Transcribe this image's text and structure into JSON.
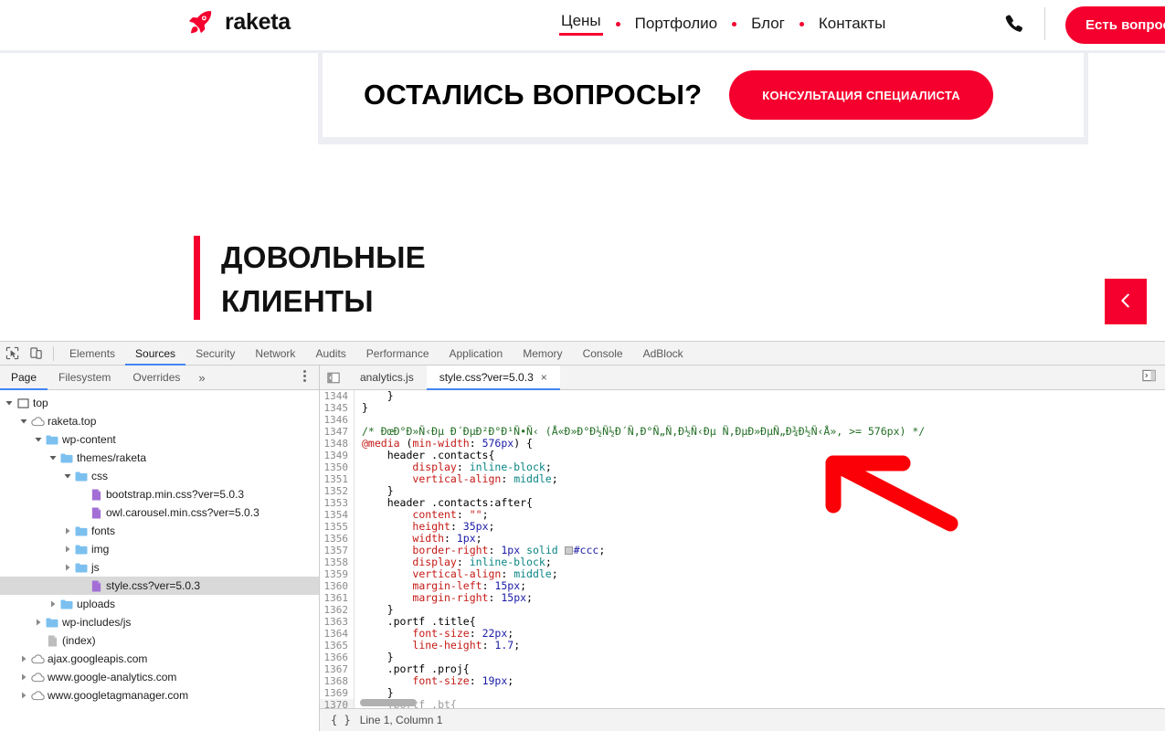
{
  "site": {
    "logo_text": "raketa",
    "logo_icon": "rocket-icon",
    "nav": [
      {
        "label": "Цены",
        "active": true
      },
      {
        "label": "Портфолио",
        "active": false
      },
      {
        "label": "Блог",
        "active": false
      },
      {
        "label": "Контакты",
        "active": false
      }
    ],
    "phone_icon": "phone-icon",
    "cta_label": "Есть вопросы?",
    "banner": {
      "title": "ОСТАЛИСЬ ВОПРОСЫ?",
      "button_label": "КОНСУЛЬТАЦИЯ СПЕЦИАЛИСТА"
    },
    "clients": {
      "line1": "ДОВОЛЬНЫЕ",
      "line2": "КЛИЕНТЫ"
    },
    "carousel_prev_icon": "chevron-left-icon",
    "colors": {
      "accent": "#f5002e",
      "banner_bg": "#eceef4",
      "text": "#111111"
    }
  },
  "devtools": {
    "left_icons": [
      "inspect-element-icon",
      "device-toolbar-icon"
    ],
    "tabs": [
      {
        "label": "Elements",
        "active": false
      },
      {
        "label": "Sources",
        "active": true
      },
      {
        "label": "Security",
        "active": false
      },
      {
        "label": "Network",
        "active": false
      },
      {
        "label": "Audits",
        "active": false
      },
      {
        "label": "Performance",
        "active": false
      },
      {
        "label": "Application",
        "active": false
      },
      {
        "label": "Memory",
        "active": false
      },
      {
        "label": "Console",
        "active": false
      },
      {
        "label": "AdBlock",
        "active": false
      }
    ],
    "navigator": {
      "subtabs": [
        {
          "label": "Page",
          "active": true
        },
        {
          "label": "Filesystem",
          "active": false
        },
        {
          "label": "Overrides",
          "active": false
        }
      ],
      "more_label": "»",
      "menu_icon": "kebab-menu-icon",
      "tree": [
        {
          "label": "top",
          "indent": 0,
          "icon": "frame-icon",
          "arrow": "expanded",
          "selected": false
        },
        {
          "label": "raketa.top",
          "indent": 1,
          "icon": "cloud-icon",
          "arrow": "expanded",
          "selected": false
        },
        {
          "label": "wp-content",
          "indent": 2,
          "icon": "folder-icon",
          "arrow": "expanded",
          "selected": false
        },
        {
          "label": "themes/raketa",
          "indent": 3,
          "icon": "folder-icon",
          "arrow": "expanded",
          "selected": false
        },
        {
          "label": "css",
          "indent": 4,
          "icon": "folder-icon",
          "arrow": "expanded",
          "selected": false
        },
        {
          "label": "bootstrap.min.css?ver=5.0.3",
          "indent": 5,
          "icon": "css-file-icon",
          "arrow": "none",
          "selected": false
        },
        {
          "label": "owl.carousel.min.css?ver=5.0.3",
          "indent": 5,
          "icon": "css-file-icon",
          "arrow": "none",
          "selected": false
        },
        {
          "label": "fonts",
          "indent": 4,
          "icon": "folder-icon",
          "arrow": "collapsed",
          "selected": false
        },
        {
          "label": "img",
          "indent": 4,
          "icon": "folder-icon",
          "arrow": "collapsed",
          "selected": false
        },
        {
          "label": "js",
          "indent": 4,
          "icon": "folder-icon",
          "arrow": "collapsed",
          "selected": false
        },
        {
          "label": "style.css?ver=5.0.3",
          "indent": 5,
          "icon": "css-file-icon",
          "arrow": "none",
          "selected": true
        },
        {
          "label": "uploads",
          "indent": 3,
          "icon": "folder-icon",
          "arrow": "collapsed",
          "selected": false
        },
        {
          "label": "wp-includes/js",
          "indent": 2,
          "icon": "folder-icon",
          "arrow": "collapsed",
          "selected": false
        },
        {
          "label": "(index)",
          "indent": 2,
          "icon": "doc-file-icon",
          "arrow": "none",
          "selected": false
        },
        {
          "label": "ajax.googleapis.com",
          "indent": 1,
          "icon": "cloud-icon",
          "arrow": "collapsed",
          "selected": false
        },
        {
          "label": "www.google-analytics.com",
          "indent": 1,
          "icon": "cloud-icon",
          "arrow": "collapsed",
          "selected": false
        },
        {
          "label": "www.googletagmanager.com",
          "indent": 1,
          "icon": "cloud-icon",
          "arrow": "collapsed",
          "selected": false
        }
      ]
    },
    "editor": {
      "panel_icon_left": "show-navigator-icon",
      "panel_icon_right": "show-sidebar-icon",
      "tabs": [
        {
          "label": "analytics.js",
          "active": false,
          "closable": false
        },
        {
          "label": "style.css?ver=5.0.3",
          "active": true,
          "closable": true
        }
      ],
      "close_glyph": "×",
      "first_line_number": 1344,
      "lines": [
        "    }",
        "}",
        "",
        "/* ÐœÐ°Ð»Ñ‹Ðµ Ð´ÐµÐ²Ð°Ð¹Ñ•Ñ‹ (Å«Ð»Ð°Ð½Ñ½Ð´Ñ‚Ð°Ñ„Ñ‚Ð½Ñ‹Ðµ Ñ‚ÐµÐ»ÐµÑ„Ð¾Ð½Ñ‹Å», >= 576px) */",
        "@media (min-width: 576px) {",
        "    header .contacts{",
        "        display: inline-block;",
        "        vertical-align: middle;",
        "    }",
        "    header .contacts:after{",
        "        content: \"\";",
        "        height: 35px;",
        "        width: 1px;",
        "        border-right: 1px solid #ccc;",
        "        display: inline-block;",
        "        vertical-align: middle;",
        "        margin-left: 15px;",
        "        margin-right: 15px;",
        "    }",
        "    .portf .title{",
        "        font-size: 22px;",
        "        line-height: 1.7;",
        "    }",
        "    .portf .proj{",
        "        font-size: 19px;",
        "    }",
        "    .portf .bt{"
      ],
      "status": {
        "format_icon": "{ }",
        "cursor_position": "Line 1, Column 1"
      }
    }
  },
  "annotation": {
    "arrow_icon": "red-arrow-annotation",
    "color": "#fb0007"
  }
}
